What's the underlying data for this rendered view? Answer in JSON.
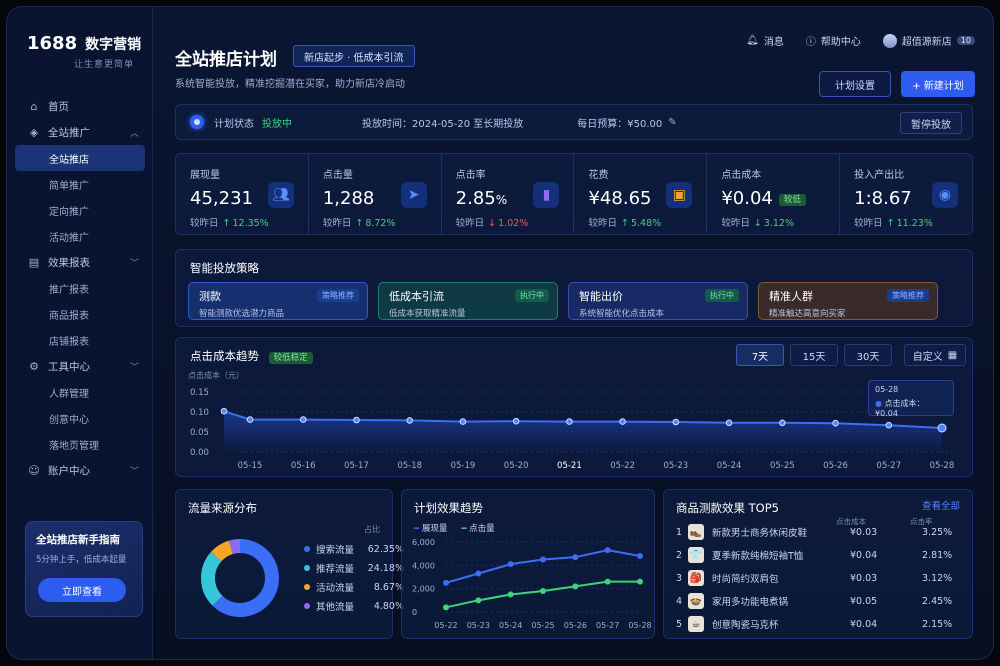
{
  "app": {
    "logo_num": "1688",
    "logo_text": "数字营销",
    "logo_sub": "让生意更简单"
  },
  "sidebar": {
    "home": "首页",
    "promo": "全站推广",
    "promo_items": [
      "全站推店",
      "简单推广",
      "定向推广",
      "活动推广"
    ],
    "reports": "效果报表",
    "report_items": [
      "推广报表",
      "商品报表",
      "店铺报表"
    ],
    "tools": "工具中心",
    "tool_items": [
      "人群管理",
      "创意中心",
      "落地页管理"
    ],
    "account": "账户中心",
    "guide_title": "全站推店新手指南",
    "guide_desc": "5分钟上手，低成本起量",
    "guide_btn": "立即查看"
  },
  "header": {
    "title": "全站推店计划",
    "tag": "新店起步 · 低成本引流",
    "subtitle": "系统智能投放，精准挖掘潜在买家，助力新店冷启动",
    "messages": "消息",
    "help": "帮助中心",
    "user": "超值源新店",
    "user_tag": "10",
    "plan_settings": "计划设置",
    "new_plan": "+ 新建计划"
  },
  "status": {
    "label": "计划状态",
    "value": "投放中",
    "period": "投放时间：2024-05-20 至长期投放",
    "budget": "每日预算：¥50.00",
    "pause": "暂停投放"
  },
  "kpis": [
    {
      "label": "展现量",
      "value": "45,231",
      "unit": "",
      "cmp_label": "较昨日",
      "arrow": "↑",
      "change": "12.35%",
      "dir": "up",
      "icon": "users-icon",
      "tag": ""
    },
    {
      "label": "点击量",
      "value": "1,288",
      "unit": "",
      "cmp_label": "较昨日",
      "arrow": "↑",
      "change": "8.72%",
      "dir": "up",
      "icon": "cursor-icon",
      "tag": ""
    },
    {
      "label": "点击率",
      "value": "2.85",
      "unit": "%",
      "cmp_label": "较昨日",
      "arrow": "↓",
      "change": "1.02%",
      "dir": "down",
      "icon": "bar-chart-icon",
      "tag": ""
    },
    {
      "label": "花费",
      "value": "¥48.65",
      "unit": "",
      "cmp_label": "较昨日",
      "arrow": "↑",
      "change": "5.48%",
      "dir": "up",
      "icon": "wallet-icon",
      "tag": ""
    },
    {
      "label": "点击成本",
      "value": "¥0.04",
      "unit": "",
      "cmp_label": "较昨日",
      "arrow": "↓",
      "change": "3.12%",
      "dir": "up",
      "icon": "",
      "tag": "较低"
    },
    {
      "label": "投入产出比",
      "value": "1:8.67",
      "unit": "",
      "cmp_label": "较昨日",
      "arrow": "↑",
      "change": "11.23%",
      "dir": "up",
      "icon": "coins-icon",
      "tag": ""
    }
  ],
  "strategy": {
    "title": "智能投放策略",
    "cards": [
      {
        "name": "测款",
        "desc": "智能测款优选潜力商品",
        "tag": "策略推荐",
        "bg": "#16306f",
        "border": "#2f58d0",
        "tagbg": "#1c3c8f",
        "tagcolor": "#8fb0ff"
      },
      {
        "name": "低成本引流",
        "desc": "低成本获取精准流量",
        "tag": "执行中",
        "bg": "#0f3a44",
        "border": "#1f7a78",
        "tagbg": "#145a4a",
        "tagcolor": "#6fe3b5"
      },
      {
        "name": "智能出价",
        "desc": "系统智能优化点击成本",
        "tag": "执行中",
        "bg": "#182a66",
        "border": "#3a4fb0",
        "tagbg": "#145a4a",
        "tagcolor": "#6fe3b5"
      },
      {
        "name": "精准人群",
        "desc": "精准触达高意向买家",
        "tag": "策略推荐",
        "bg": "#3a2a2a",
        "border": "#7a5a3a",
        "tagbg": "#1c3c8f",
        "tagcolor": "#8fb0ff"
      }
    ]
  },
  "trend": {
    "title": "点击成本趋势",
    "tag": "较低稳定",
    "ylabel": "点击成本（元）",
    "ranges": [
      "7天",
      "15天",
      "30天"
    ],
    "custom": "自定义",
    "tooltip_date": "05-28",
    "tooltip_label": "点击成本：",
    "tooltip_value": "¥0.04",
    "x": [
      "05-15",
      "05-16",
      "05-17",
      "05-18",
      "05-19",
      "05-20",
      "05-21",
      "05-22",
      "05-23",
      "05-24",
      "05-25",
      "05-26",
      "05-27",
      "05-28"
    ],
    "y": [
      0.102,
      0.081,
      0.081,
      0.08,
      0.079,
      0.076,
      0.077,
      0.076,
      0.076,
      0.075,
      0.073,
      0.073,
      0.072,
      0.067,
      0.06,
      0.056
    ],
    "yticks": [
      "0.15",
      "0.10",
      "0.05",
      "0.00"
    ]
  },
  "chart_data": [
    {
      "type": "area",
      "title": "点击成本趋势",
      "ylabel": "点击成本（元）",
      "x": [
        "05-15",
        "05-16",
        "05-17",
        "05-18",
        "05-19",
        "05-20",
        "05-21",
        "05-22",
        "05-23",
        "05-24",
        "05-25",
        "05-26",
        "05-27",
        "05-28"
      ],
      "values": [
        0.081,
        0.081,
        0.08,
        0.079,
        0.076,
        0.077,
        0.076,
        0.076,
        0.075,
        0.073,
        0.073,
        0.072,
        0.067,
        0.06
      ],
      "ylim": [
        0,
        0.15
      ]
    },
    {
      "type": "pie",
      "title": "流量来源分布",
      "categories": [
        "搜索流量",
        "推荐流量",
        "活动流量",
        "其他流量"
      ],
      "values": [
        62.35,
        24.18,
        8.67,
        4.8
      ],
      "colors": [
        "#3b6ef6",
        "#34c6d9",
        "#f5a623",
        "#8b6cf2"
      ]
    },
    {
      "type": "line",
      "title": "计划效果趋势",
      "categories": [
        "05-22",
        "05-23",
        "05-24",
        "05-25",
        "05-26",
        "05-27",
        "05-28"
      ],
      "series": [
        {
          "name": "展现量",
          "values": [
            2500,
            3300,
            4100,
            4500,
            4700,
            5300,
            4800
          ],
          "color": "#3b6ef6"
        },
        {
          "name": "点击量",
          "values": [
            400,
            1000,
            1500,
            1800,
            2200,
            2600,
            2600
          ],
          "color": "#3ed37a"
        }
      ],
      "yticks": [
        "6,000",
        "4,000",
        "2,000",
        "0"
      ],
      "ylim": [
        0,
        6000
      ]
    }
  ],
  "traffic": {
    "title": "流量来源分布",
    "col": "占比",
    "items": [
      {
        "name": "搜索流量",
        "pct": "62.35%",
        "color": "#3b6ef6"
      },
      {
        "name": "推荐流量",
        "pct": "24.18%",
        "color": "#34c6d9"
      },
      {
        "name": "活动流量",
        "pct": "8.67%",
        "color": "#f5a623"
      },
      {
        "name": "其他流量",
        "pct": "4.80%",
        "color": "#8b6cf2"
      }
    ]
  },
  "effect": {
    "title": "计划效果趋势",
    "legend": [
      "展现量",
      "点击量"
    ]
  },
  "top5": {
    "title": "商品测款效果 TOP5",
    "more": "查看全部",
    "col_cpc": "点击成本",
    "col_ctr": "点击率",
    "rows": [
      {
        "rank": "1",
        "name": "新款男士商务休闲皮鞋",
        "cpc": "¥0.03",
        "ctr": "3.25%",
        "icon": "shoe-icon",
        "glyph": "👞"
      },
      {
        "rank": "2",
        "name": "夏季新款纯棉短袖T恤",
        "cpc": "¥0.04",
        "ctr": "2.81%",
        "icon": "tshirt-icon",
        "glyph": "👕"
      },
      {
        "rank": "3",
        "name": "时尚简约双肩包",
        "cpc": "¥0.03",
        "ctr": "3.12%",
        "icon": "backpack-icon",
        "glyph": "🎒"
      },
      {
        "rank": "4",
        "name": "家用多功能电煮锅",
        "cpc": "¥0.05",
        "ctr": "2.45%",
        "icon": "pot-icon",
        "glyph": "🍲"
      },
      {
        "rank": "5",
        "name": "创意陶瓷马克杯",
        "cpc": "¥0.04",
        "ctr": "2.15%",
        "icon": "mug-icon",
        "glyph": "☕"
      }
    ]
  }
}
